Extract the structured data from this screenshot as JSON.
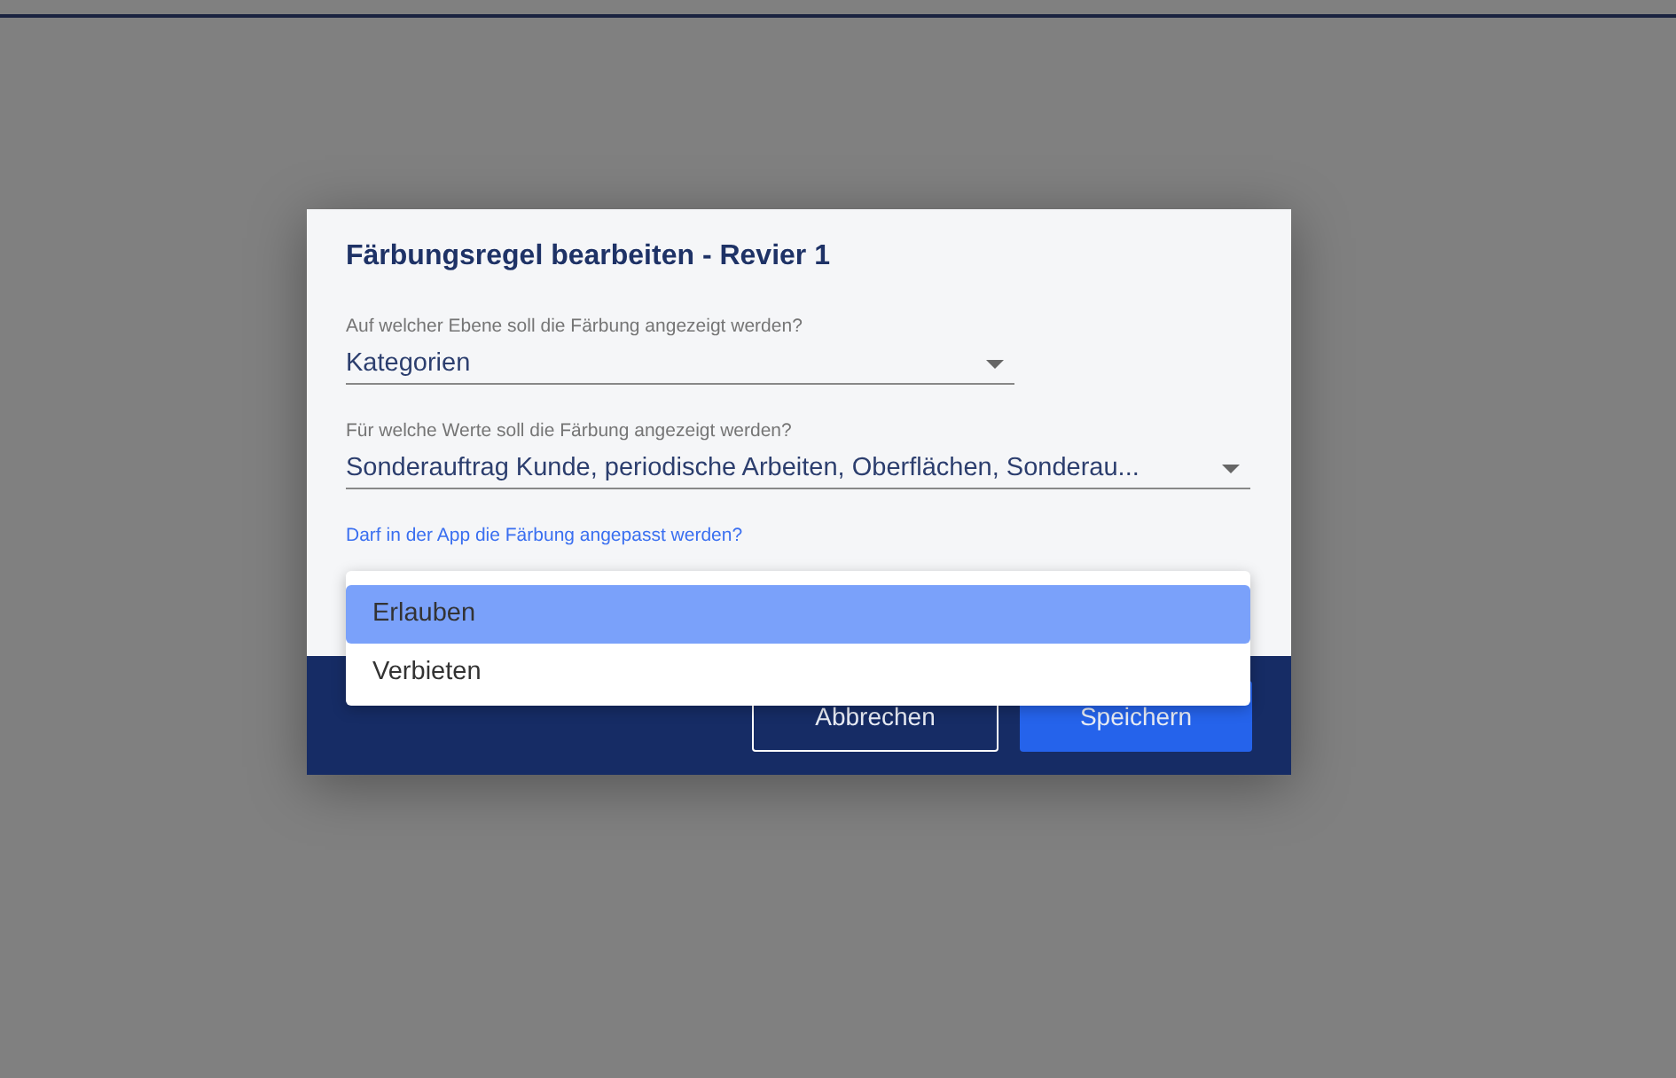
{
  "dialog": {
    "title": "Färbungsregel bearbeiten - Revier 1",
    "fields": [
      {
        "label": "Auf welcher Ebene soll die Färbung angezeigt werden?",
        "value": "Kategorien",
        "kind": "short"
      },
      {
        "label": "Für welche Werte soll die Färbung angezeigt werden?",
        "value": "Sonderauftrag Kunde, periodische Arbeiten, Oberflächen, Sonderau...",
        "kind": "wide"
      }
    ],
    "question": "Darf in der App die Färbung angepasst werden?",
    "menu": [
      {
        "label": "Erlauben",
        "selected": true
      },
      {
        "label": "Verbieten",
        "selected": false
      }
    ],
    "buttons": [
      {
        "label": "Abbrechen",
        "kind": "outline"
      },
      {
        "label": "Speichern",
        "kind": "primary"
      }
    ]
  }
}
